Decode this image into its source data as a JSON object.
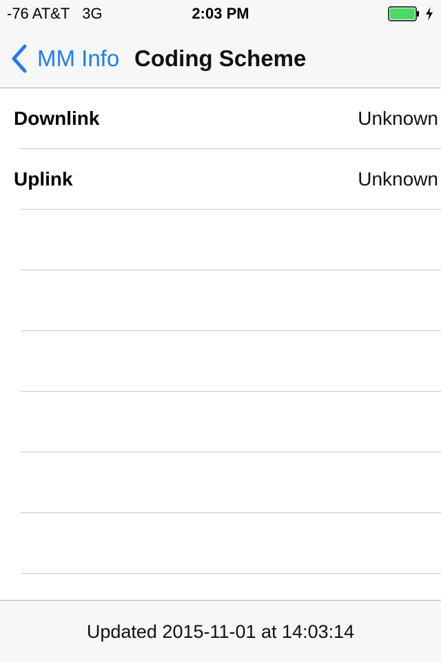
{
  "status_bar": {
    "carrier": "-76 AT&T",
    "network": "3G",
    "time": "2:03 PM",
    "battery_color": "#4cd964",
    "battery_icon": "battery-charging-icon",
    "charging_icon": "bolt-icon"
  },
  "nav": {
    "back_label": "MM Info",
    "title": "Coding Scheme",
    "accent": "#1a7ef5"
  },
  "rows": [
    {
      "label": "Downlink",
      "value": "Unknown"
    },
    {
      "label": "Uplink",
      "value": "Unknown"
    }
  ],
  "footer": {
    "updated": "Updated 2015-11-01 at 14:03:14"
  }
}
